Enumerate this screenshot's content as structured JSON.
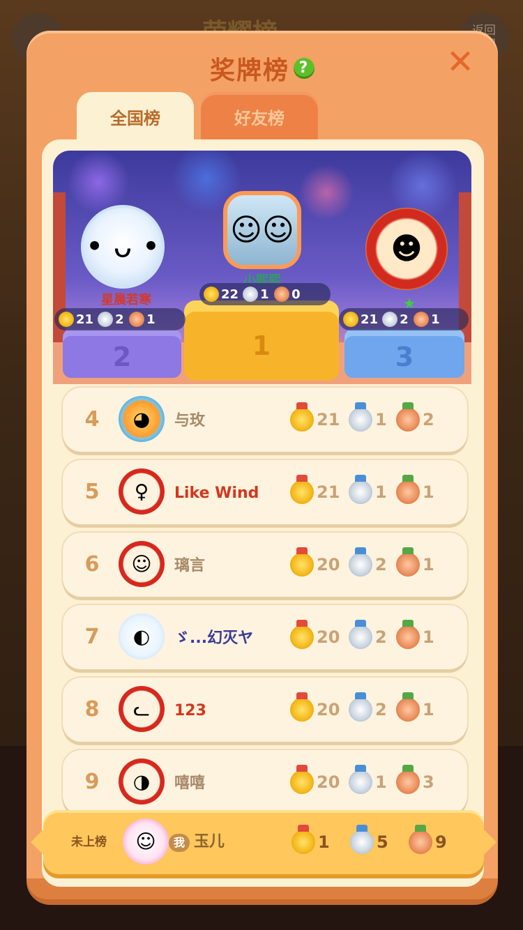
{
  "background": {
    "title": "荣耀榜",
    "back_label": "返回\n家园"
  },
  "modal": {
    "title": "奖牌榜",
    "help_icon": "?",
    "close_icon": "✕"
  },
  "tabs": [
    {
      "label": "全国榜",
      "active": true
    },
    {
      "label": "好友榜",
      "active": false
    }
  ],
  "podium": {
    "first": {
      "rank": "1",
      "name": "小熙熙",
      "gold": 22,
      "silver": 1,
      "bronze": 0
    },
    "second": {
      "rank": "2",
      "name": "星晨若寒",
      "gold": 21,
      "silver": 2,
      "bronze": 1
    },
    "third": {
      "rank": "3",
      "name": "",
      "gold": 21,
      "silver": 2,
      "bronze": 1
    }
  },
  "rows": [
    {
      "rank": "4",
      "name": "与玫",
      "gold": "21",
      "silver": "1",
      "bronze": "2"
    },
    {
      "rank": "5",
      "name": "Like Wind",
      "gold": "21",
      "silver": "1",
      "bronze": "1"
    },
    {
      "rank": "6",
      "name": "璃言",
      "gold": "20",
      "silver": "2",
      "bronze": "1"
    },
    {
      "rank": "7",
      "name": "ゞ...幻灭ヤ",
      "gold": "20",
      "silver": "2",
      "bronze": "1"
    },
    {
      "rank": "8",
      "name": "123",
      "gold": "20",
      "silver": "2",
      "bronze": "1"
    },
    {
      "rank": "9",
      "name": "嘻嘻",
      "gold": "20",
      "silver": "1",
      "bronze": "3"
    }
  ],
  "me": {
    "status": "未上榜",
    "badge": "我",
    "name": "玉儿",
    "gold": "1",
    "silver": "5",
    "bronze": "9"
  },
  "colors": {
    "modal_orange": "#f4a165",
    "panel_cream": "#fdf1d4",
    "gold_medal": "#f4b81a",
    "silver_medal": "#c8d3e0",
    "bronze_medal": "#ea8d5b"
  }
}
